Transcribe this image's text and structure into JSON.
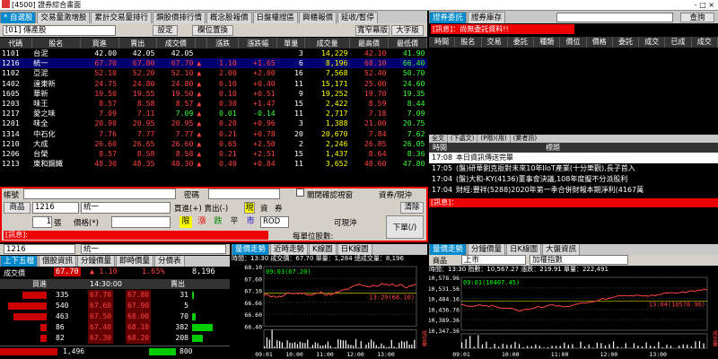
{
  "window": {
    "title": "[4500] 證券綜合畫面",
    "controls": "- □ ×"
  },
  "main_tabs": [
    "* 自選股",
    "交易量激增股",
    "累計交易量排行",
    "類股價排行情",
    "概念股報價",
    "日盤權證區",
    "興櫃報價",
    "延收/暫停"
  ],
  "left_toolbar": {
    "group": "[01] 傳產股",
    "settings": "設定",
    "columns": "欄位置換",
    "wide_narrow": "寬窄幕版",
    "large_font": "大字版"
  },
  "quote_table": {
    "headers": [
      "代碼",
      "股名",
      "買進",
      "賣出",
      "成交價",
      "",
      "漲跌",
      "漲跌幅",
      "單量",
      "成交量",
      "最高價",
      "最低價"
    ],
    "rows": [
      [
        "1101",
        "台泥",
        "42.00",
        "42.05",
        "42.05",
        "",
        "",
        "",
        "3",
        "14,229",
        "42.10",
        "41.90"
      ],
      [
        "1216",
        "統一",
        "67.70",
        "67.80",
        "67.70",
        "▲",
        "1.10",
        "+1.65",
        "6",
        "8,196",
        "68.10",
        "66.40"
      ],
      [
        "1102",
        "亞泥",
        "52.10",
        "52.20",
        "52.10",
        "▲",
        "2.00",
        "+2.00",
        "16",
        "7,568",
        "52.40",
        "50.70"
      ],
      [
        "1402",
        "遠東新",
        "24.75",
        "24.80",
        "24.80",
        "▲",
        "0.10",
        "+0.40",
        "11",
        "15,171",
        "25.00",
        "24.60"
      ],
      [
        "1605",
        "華新",
        "19.50",
        "19.55",
        "19.50",
        "▲",
        "0.10",
        "+0.51",
        "9",
        "19,252",
        "19.70",
        "19.35"
      ],
      [
        "1203",
        "味王",
        "8.57",
        "8.58",
        "8.57",
        "▲",
        "0.30",
        "+1.47",
        "15",
        "2,422",
        "8.59",
        "8.44"
      ],
      [
        "1217",
        "愛之味",
        "7.09",
        "7.11",
        "7.09",
        "▲",
        "0.01",
        "-0.14",
        "11",
        "2,717",
        "7.18",
        "7.09"
      ],
      [
        "1201",
        "味全",
        "20.90",
        "20.95",
        "20.95",
        "▲",
        "0.20",
        "+0.96",
        "3",
        "1,388",
        "21.00",
        "20.75"
      ],
      [
        "1314",
        "中石化",
        "7.76",
        "7.77",
        "7.77",
        "▲",
        "0.21",
        "+0.78",
        "20",
        "20,670",
        "7.84",
        "7.62"
      ],
      [
        "1210",
        "大成",
        "26.60",
        "26.65",
        "26.60",
        "▲",
        "0.65",
        "+2.50",
        "2",
        "2,246",
        "26.85",
        "26.05"
      ],
      [
        "1206",
        "台榮",
        "8.57",
        "8.58",
        "8.58",
        "▲",
        "0.21",
        "+2.51",
        "15",
        "1,437",
        "8.64",
        "8.36"
      ],
      [
        "1213",
        "東和鋼鐵",
        "48.30",
        "48.35",
        "48.30",
        "▲",
        "0.40",
        "+0.84",
        "11",
        "3,652",
        "48.60",
        "47.80"
      ]
    ]
  },
  "order_panel": {
    "account_label": "帳號",
    "password_label": "密碼",
    "product_label": "商品",
    "stock_code": "1216",
    "stock_name": "統一",
    "buy_sell_label": "買進(+) 賣出(-)",
    "cash": "現",
    "cash_credit": "資",
    "short": "券",
    "clear": "清除",
    "qty_unit": "張",
    "price_label": "價格(*)",
    "qty": "1",
    "price_types": [
      "限",
      "漲",
      "跌",
      "平",
      "市"
    ],
    "rod": "ROD",
    "available": "可現沖",
    "order_button": "下單(/)",
    "confirm_checkbox": "關閉確認視窗",
    "day_trade": "資券/現沖",
    "message_label": "[訊息]:",
    "shares_label": "每單位股數:"
  },
  "order_tabs": [
    "證券委託",
    "證券庫存"
  ],
  "query_button": "查詢",
  "order_table_headers": [
    "時間",
    "股名",
    "交易",
    "委託",
    "種類",
    "價位",
    "價格",
    "委託",
    "成交",
    "已成",
    "成交"
  ],
  "order_message": "[訊息]：尚無委託資料!!",
  "news": {
    "tabs": [
      "全文",
      "(下處文)",
      "(P階)(用)",
      "(業者訊)"
    ],
    "headers": [
      "時間",
      "標題"
    ],
    "message": "[訊息]：",
    "items": [
      {
        "time": "17:08",
        "title": "本日資訊傳送完畢"
      },
      {
        "time": "17:05",
        "title": "(盤)研華劉克振對未來10年IIoT產業(十分樂觀),長子首入"
      },
      {
        "time": "17:04",
        "title": "(盤)大和-KY(4136)董事會決議,108年度擬不分派股利"
      },
      {
        "time": "17:04",
        "title": "財經:豐祥(5288)2020年第一季合併財報本期淨利(4167萬"
      }
    ]
  },
  "stock_bar": {
    "code": "1216",
    "name": "統一"
  },
  "depth": {
    "tabs": [
      "上下五檔",
      "個股資訊",
      "分鐘價量",
      "即時價量",
      "分價表"
    ],
    "vol_label": "成交價",
    "price": "67.70",
    "change": "▲ 1.10",
    "pct": "1.65%",
    "volume": "8,196",
    "headers": [
      "買進",
      "14:30:00",
      "賣出"
    ],
    "rows": [
      {
        "bid_qty": "335",
        "bid": "67.70",
        "ask": "67.80",
        "ask_qty": "31"
      },
      {
        "bid_qty": "540",
        "bid": "67.60",
        "ask": "67.90",
        "ask_qty": "5"
      },
      {
        "bid_qty": "463",
        "bid": "67.50",
        "ask": "68.00",
        "ask_qty": "70"
      },
      {
        "bid_qty": "86",
        "bid": "67.40",
        "ask": "68.10",
        "ask_qty": "382"
      },
      {
        "bid_qty": "82",
        "bid": "67.30",
        "ask": "68.20",
        "ask_qty": "208"
      }
    ],
    "total_bid": "1,496",
    "total_ask": "800"
  },
  "mid_chart": {
    "tabs": [
      "量價走勢",
      "近時走勢",
      "K線圖",
      "日K線圖"
    ],
    "header": "時間：13:30 成交價：67.70 單量：1,284 總成交量：8,196",
    "open_label": "09:03(67.20)",
    "close_label": "13:29(68.10)",
    "y_ticks": [
      "68.10",
      "67.60",
      "67.10",
      "66.66",
      "66.60",
      "66.40"
    ],
    "x_ticks": [
      "09:01",
      "10:00",
      "11:00",
      "12:00",
      "13:00"
    ],
    "vol_label": "成交量"
  },
  "right_chart": {
    "tabs": [
      "量價走勢",
      "分鐘價量",
      "日K線圖",
      "大盤資訊"
    ],
    "product_label": "商品",
    "market": "上市",
    "index": "加權指數",
    "header": "時間：13:30 指數：10,567.27 漲跌：219.91 單量：222,491",
    "open_label": "09:01(10407.45)",
    "close_label": "13:04(10578.96)",
    "y_ticks": [
      "10,578.96",
      "10,531.56",
      "10,484.16",
      "10,436.76",
      "10,389.36",
      "10,347.36"
    ],
    "x_ticks": [
      "09:01",
      "10:00",
      "11:00",
      "12:00",
      "13:00"
    ],
    "vol_label": "成交量"
  }
}
